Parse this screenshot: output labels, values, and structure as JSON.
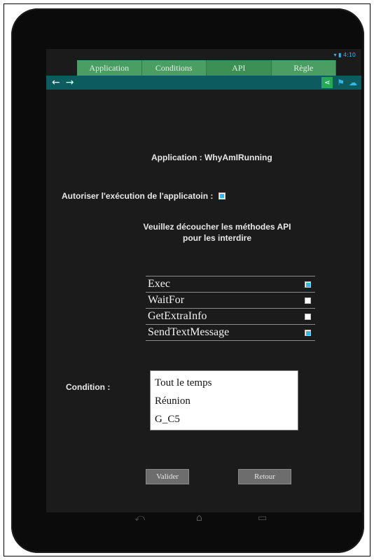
{
  "status": {
    "time": "4:10"
  },
  "tabs": [
    {
      "label": "Application"
    },
    {
      "label": "Conditions"
    },
    {
      "label": "API"
    },
    {
      "label": "Règle"
    }
  ],
  "actionbar": {
    "back_icon": "arrow-left-icon",
    "forward_icon": "arrow-right-icon",
    "share_icon": "share-icon",
    "icon2": "flag-icon",
    "icon3": "cloud-icon"
  },
  "app": {
    "title": "Application : WhyAmIRunning"
  },
  "autoriser": {
    "label": "Autoriser l'exécution de l'applicatoin :",
    "checked": true
  },
  "instructions": {
    "line1": "Veuillez découcher les méthodes API",
    "line2": "pour les interdire"
  },
  "api_methods": [
    {
      "name": "Exec",
      "checked": true
    },
    {
      "name": "WaitFor",
      "checked": false
    },
    {
      "name": "GetExtraInfo",
      "checked": false
    },
    {
      "name": "SendTextMessage",
      "checked": true
    }
  ],
  "condition": {
    "label": "Condition :",
    "options": [
      "Tout le temps",
      "Réunion",
      "G_C5"
    ]
  },
  "buttons": {
    "valider": "Valider",
    "retour": "Retour"
  },
  "colors": {
    "tab_green": "#4a9e63",
    "actionbar": "#0c5b5e",
    "accent": "#33b5e5"
  }
}
